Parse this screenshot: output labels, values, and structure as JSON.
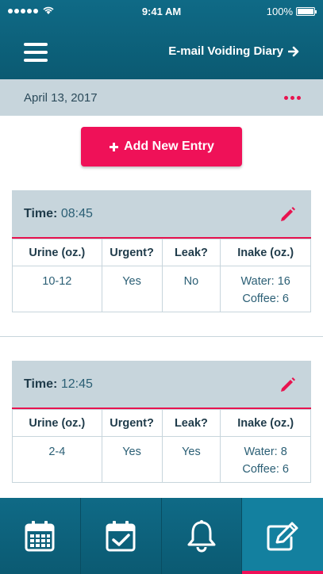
{
  "status_bar": {
    "time": "9:41 AM",
    "battery": "100%"
  },
  "header": {
    "email_label": "E-mail Voiding Diary"
  },
  "date_bar": {
    "date": "April 13, 2017"
  },
  "add_button": {
    "label": "Add New Entry"
  },
  "table_headers": [
    "Urine (oz.)",
    "Urgent?",
    "Leak?",
    "Inake (oz.)"
  ],
  "entries": [
    {
      "time_label": "Time:",
      "time": "08:45",
      "urine": "10-12",
      "urgent": "Yes",
      "leak": "No",
      "intake_line1": "Water: 16",
      "intake_line2": "Coffee: 6"
    },
    {
      "time_label": "Time:",
      "time": "12:45",
      "urine": "2-4",
      "urgent": "Yes",
      "leak": "Yes",
      "intake_line1": "Water: 8",
      "intake_line2": "Coffee: 6"
    }
  ],
  "tabs": [
    {
      "icon": "calendar-icon"
    },
    {
      "icon": "calendar-check-icon"
    },
    {
      "icon": "bell-icon"
    },
    {
      "icon": "edit-icon",
      "active": true
    }
  ],
  "colors": {
    "header": "#0b5a72",
    "accent": "#ef1158",
    "bar": "#c7d5dc"
  }
}
